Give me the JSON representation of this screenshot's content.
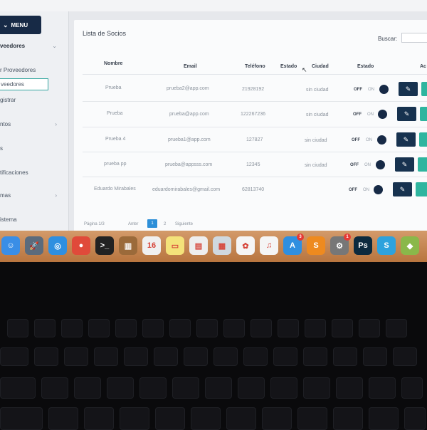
{
  "sidebar": {
    "menu_label": "MENU",
    "items": [
      {
        "label": "veedores",
        "caret": "⌄"
      },
      {
        "label": "r Proveedores"
      },
      {
        "label": "veedores",
        "active": true
      },
      {
        "label": "gistrar"
      },
      {
        "label": "ntos",
        "caret": "›"
      },
      {
        "label": "s"
      },
      {
        "label": "tificaciones"
      },
      {
        "label": "mas",
        "caret": "›"
      },
      {
        "label": "istema"
      }
    ]
  },
  "panel": {
    "title": "Lista de Socios",
    "search_label": "Buscar:",
    "search_value": ""
  },
  "table": {
    "headers": [
      "Nombre",
      "Email",
      "Teléfono",
      "Estado",
      "Ciudad",
      "Estado",
      "Ac"
    ],
    "rows": [
      {
        "nombre": "Prueba",
        "email": "prueba2@app.com",
        "telefono": "21928192",
        "ciudad": "sin ciudad",
        "off": "OFF",
        "on": "ON"
      },
      {
        "nombre": "Prueba",
        "email": "prueba@app.com",
        "telefono": "122267236",
        "ciudad": "sin ciudad",
        "off": "OFF",
        "on": "ON"
      },
      {
        "nombre": "Prueba 4",
        "email": "prueba1@app.com",
        "telefono": "127827",
        "ciudad": "sin ciudad",
        "off": "OFF",
        "on": "ON"
      },
      {
        "nombre": "prueba pp",
        "email": "prueba@appsss.com",
        "telefono": "12345",
        "ciudad": "sin ciudad",
        "off": "OFF",
        "on": "ON"
      },
      {
        "nombre": "Eduardo Mirabales",
        "email": "eduardomirabales@gmail.com",
        "telefono": "62813740",
        "ciudad": "",
        "off": "OFF",
        "on": "ON"
      }
    ]
  },
  "pagination": {
    "info": "Página 1/3",
    "prev": "Anter",
    "current": "1",
    "next_num": "2",
    "next": "Siguiente"
  },
  "dock": {
    "icons": [
      {
        "name": "finder-icon",
        "glyph": "☺",
        "color": "#3a8ee6"
      },
      {
        "name": "launchpad-icon",
        "glyph": "🚀",
        "color": "#5b6b7c"
      },
      {
        "name": "safari-icon",
        "glyph": "◎",
        "color": "#2f8fe0"
      },
      {
        "name": "chrome-icon",
        "glyph": "●",
        "color": "#e04a3a"
      },
      {
        "name": "terminal-icon",
        "glyph": ">_",
        "color": "#222"
      },
      {
        "name": "notes-book-icon",
        "glyph": "▥",
        "color": "#9b6a3a"
      },
      {
        "name": "calendar-icon",
        "glyph": "16",
        "color": "#f0f0f0"
      },
      {
        "name": "stickies-icon",
        "glyph": "▭",
        "color": "#f4e27a"
      },
      {
        "name": "text-icon",
        "glyph": "▤",
        "color": "#eeeeee"
      },
      {
        "name": "preview-icon",
        "glyph": "▦",
        "color": "#cfd8df"
      },
      {
        "name": "photos-icon",
        "glyph": "✿",
        "color": "#f5f5f5"
      },
      {
        "name": "music-icon",
        "glyph": "♫",
        "color": "#f5f5f5"
      },
      {
        "name": "app-store-icon",
        "glyph": "A",
        "color": "#2f8fe0",
        "badge": "3"
      },
      {
        "name": "sublime-icon",
        "glyph": "S",
        "color": "#ee8a1f"
      },
      {
        "name": "system-preferences-icon",
        "glyph": "⚙",
        "color": "#777",
        "badge": "1"
      },
      {
        "name": "photoshop-icon",
        "glyph": "Ps",
        "color": "#0c2a3e"
      },
      {
        "name": "skype-icon",
        "glyph": "S",
        "color": "#2ea2dd"
      },
      {
        "name": "android-icon",
        "glyph": "◆",
        "color": "#8ab84a"
      }
    ]
  }
}
